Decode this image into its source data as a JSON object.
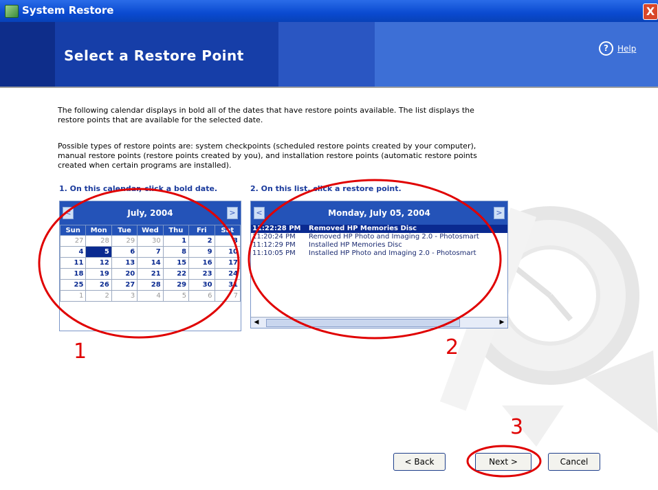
{
  "window": {
    "title": "System Restore",
    "close_label": "X"
  },
  "banner": {
    "heading": "Select a Restore Point"
  },
  "help": {
    "icon": "?",
    "label": "Help"
  },
  "intro": {
    "p1_line1": "The following calendar displays in bold all of the dates that have restore points available. The list displays the",
    "p1_line2": "restore points that are available for the selected date.",
    "p2_line1": "Possible types of restore points are: system checkpoints (scheduled restore points created by your computer),",
    "p2_line2": "manual restore points (restore points created by you), and installation restore points (automatic restore points",
    "p2_line3": "created when certain programs are installed)."
  },
  "step1": "1. On this calendar, click a bold date.",
  "step2": "2. On this list, click a restore point.",
  "calendar": {
    "month_label": "July, 2004",
    "prev": "<",
    "next": ">",
    "weekdays": [
      "Sun",
      "Mon",
      "Tue",
      "Wed",
      "Thu",
      "Fri",
      "Sat"
    ],
    "weeks": [
      [
        "27",
        "28",
        "29",
        "30",
        "1",
        "2",
        "3"
      ],
      [
        "4",
        "5",
        "6",
        "7",
        "8",
        "9",
        "10"
      ],
      [
        "11",
        "12",
        "13",
        "14",
        "15",
        "16",
        "17"
      ],
      [
        "18",
        "19",
        "20",
        "21",
        "22",
        "23",
        "24"
      ],
      [
        "25",
        "26",
        "27",
        "28",
        "29",
        "30",
        "31"
      ],
      [
        "1",
        "2",
        "3",
        "4",
        "5",
        "6",
        "7"
      ]
    ],
    "selected": "5"
  },
  "list": {
    "date_label": "Monday, July 05, 2004",
    "prev": "<",
    "next": ">",
    "rows": [
      {
        "time": "11:22:28 PM",
        "desc": "Removed HP Memories Disc"
      },
      {
        "time": "11:20:24 PM",
        "desc": "Removed HP Photo and Imaging 2.0 - Photosmart"
      },
      {
        "time": "11:12:29 PM",
        "desc": "Installed HP Memories Disc"
      },
      {
        "time": "11:10:05 PM",
        "desc": "Installed HP Photo and Imaging 2.0 - Photosmart"
      }
    ]
  },
  "annotations": {
    "a1": "1",
    "a2": "2",
    "a3": "3",
    "color": "#e00000"
  },
  "buttons": {
    "back": "< Back",
    "next": "Next >",
    "cancel": "Cancel"
  },
  "colors": {
    "title_bar": "#0a4ad0",
    "banner": "#163ea8",
    "calendar_header": "#2453b8",
    "selection": "#0a2a90"
  }
}
